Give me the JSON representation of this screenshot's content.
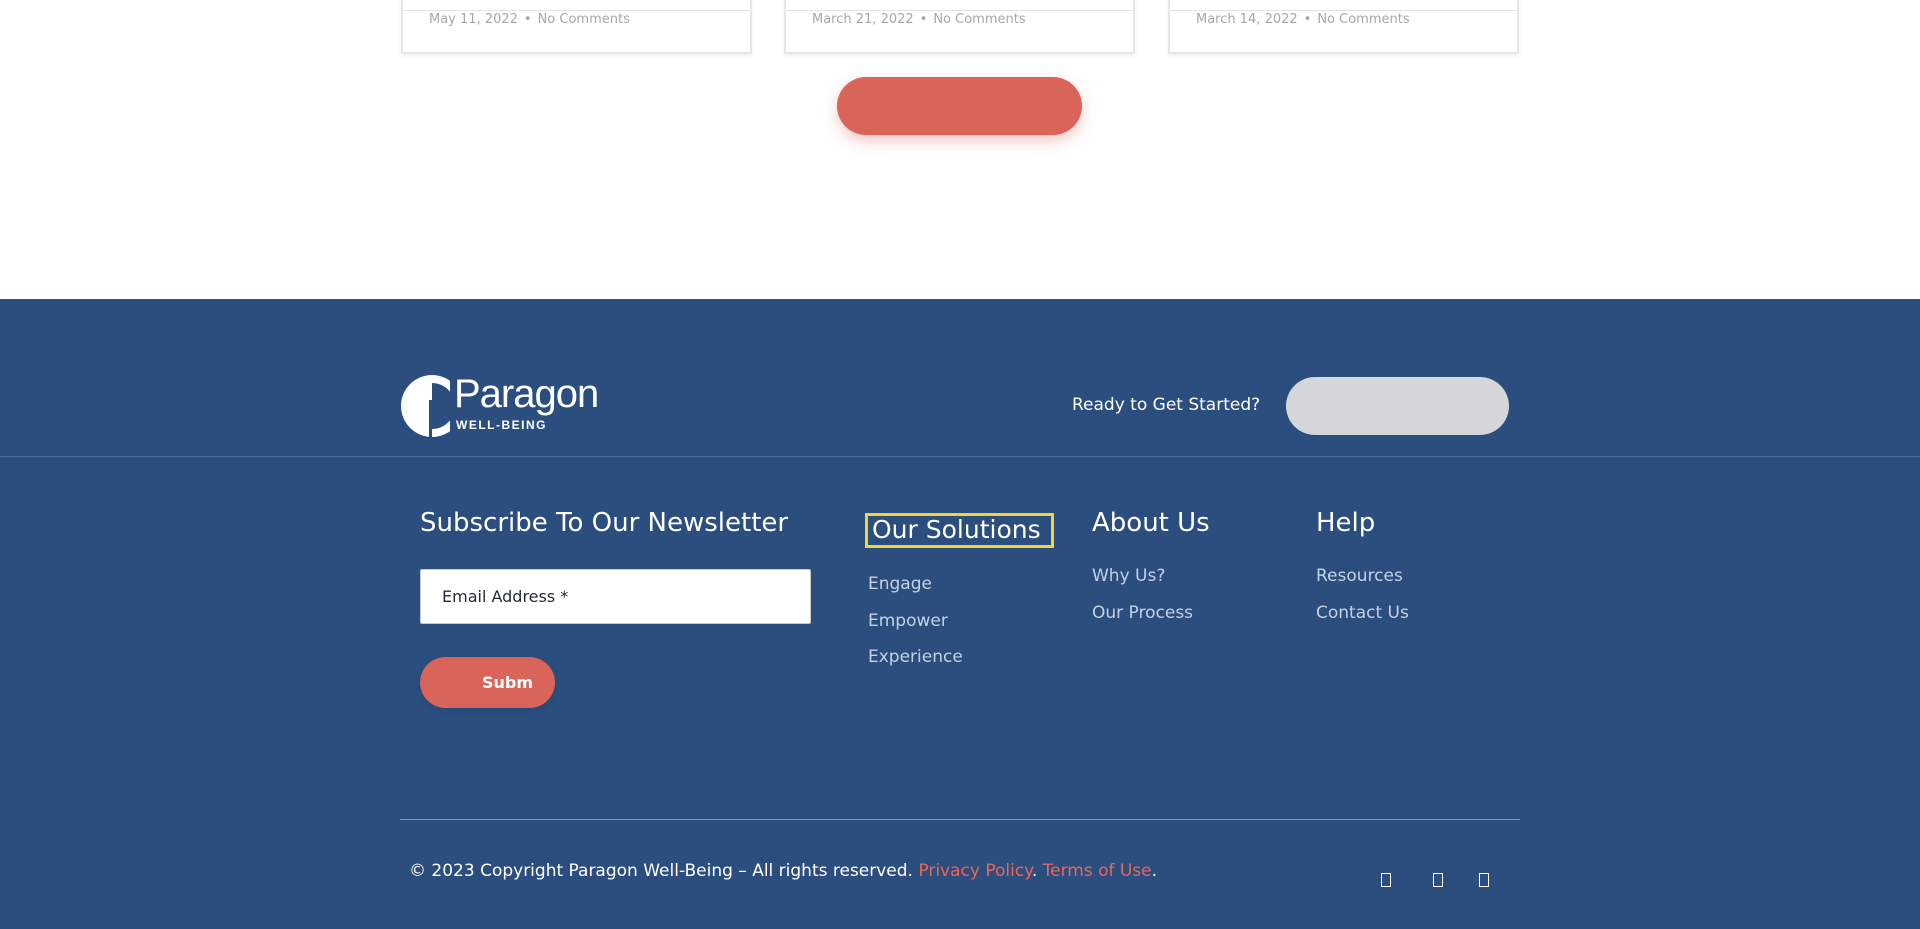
{
  "posts": [
    {
      "date": "May 11, 2022",
      "separator": "•",
      "comments": "No Comments"
    },
    {
      "date": "March 21, 2022",
      "separator": "•",
      "comments": "No Comments"
    },
    {
      "date": "March 14, 2022",
      "separator": "•",
      "comments": "No Comments"
    }
  ],
  "footer": {
    "logo": {
      "word": "Paragon",
      "sub": "WELL-BEING"
    },
    "ready_text": "Ready to Get Started?",
    "newsletter": {
      "title": "Subscribe To Our Newsletter",
      "email_placeholder": "Email Address *",
      "submit_label": "Subm"
    },
    "solutions": {
      "title": "Our Solutions",
      "links": [
        "Engage",
        "Empower",
        "Experience"
      ]
    },
    "about": {
      "title": "About Us",
      "links": [
        "Why Us?",
        "Our Process"
      ]
    },
    "help": {
      "title": "Help",
      "links": [
        "Resources",
        "Contact Us"
      ]
    },
    "copyright": {
      "text": "© 2023 Copyright Paragon Well-Being  – All rights reserved. ",
      "privacy": "Privacy Policy",
      "sep": ". ",
      "terms": "Terms of Use",
      "end": "."
    },
    "social_icons": [
      "social-icon-1",
      "social-icon-2",
      "social-icon-3"
    ]
  },
  "colors": {
    "footer_bg": "#2b4e7e",
    "accent": "#d9645a",
    "link": "#c5d1e3",
    "highlight_box": "#f1d33c"
  }
}
